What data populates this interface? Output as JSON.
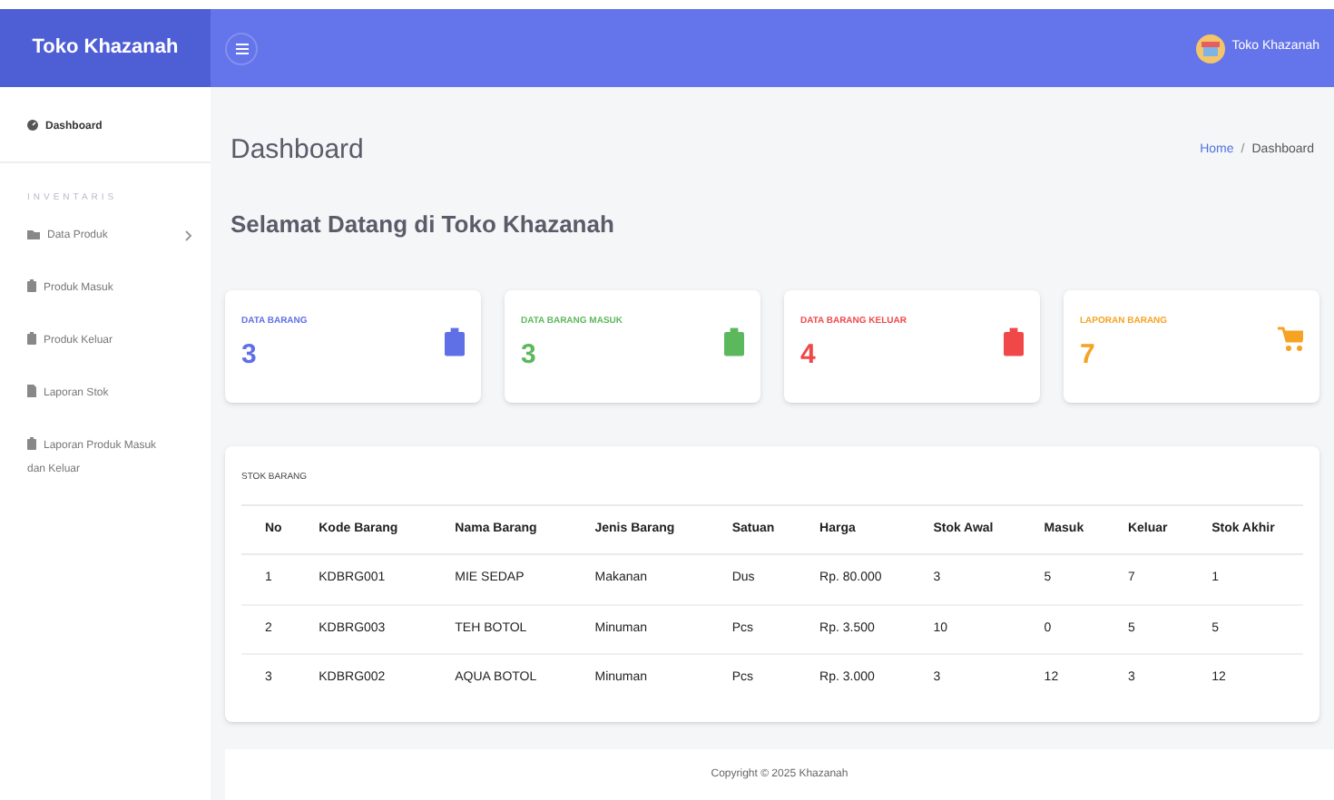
{
  "brand": "Toko Khazanah",
  "user": {
    "name": "Toko Khazanah"
  },
  "sidebar": {
    "items": [
      {
        "kind": "link",
        "label": "Dashboard",
        "selected": true
      },
      {
        "kind": "heading",
        "label": "INVENTARIS"
      },
      {
        "kind": "link",
        "label": "Data Produk",
        "selected": false,
        "has_submenu": true
      },
      {
        "kind": "link",
        "label": "Produk Masuk",
        "selected": false
      },
      {
        "kind": "link",
        "label": "Produk Keluar",
        "selected": false
      },
      {
        "kind": "link",
        "label": "Laporan Stok",
        "selected": false
      },
      {
        "kind": "link",
        "label": "Laporan Produk Masuk dan Keluar",
        "selected": false
      }
    ]
  },
  "page": {
    "title": "Dashboard",
    "breadcrumb": [
      "Home",
      "Dashboard"
    ],
    "breadcrumb_separator": "/",
    "welcome": "Selamat Datang di Toko Khazanah"
  },
  "cards": [
    {
      "label": "DATA BARANG",
      "value": "3",
      "color": "#5f6fe6"
    },
    {
      "label": "DATA BARANG MASUK",
      "value": "3",
      "color": "#5cb85c"
    },
    {
      "label": "DATA BARANG KELUAR",
      "value": "4",
      "color": "#f04848"
    },
    {
      "label": "LAPORAN BARANG",
      "value": "7",
      "color": "#f6a323"
    }
  ],
  "table": {
    "title": "STOK BARANG",
    "columns": [
      "No",
      "Kode Barang",
      "Nama Barang",
      "Jenis Barang",
      "Satuan",
      "Harga",
      "Stok Awal",
      "Masuk",
      "Keluar",
      "Stok Akhir"
    ],
    "rows": [
      [
        "1",
        "KDBRG001",
        "MIE SEDAP",
        "Makanan",
        "Dus",
        "Rp. 80.000",
        "3",
        "5",
        "7",
        "1"
      ],
      [
        "2",
        "KDBRG003",
        "TEH BOTOL",
        "Minuman",
        "Pcs",
        "Rp. 3.500",
        "10",
        "0",
        "5",
        "5"
      ],
      [
        "3",
        "KDBRG002",
        "AQUA BOTOL",
        "Minuman",
        "Pcs",
        "Rp. 3.000",
        "3",
        "12",
        "3",
        "12"
      ]
    ]
  },
  "footer": "Copyright © 2025 Khazanah"
}
